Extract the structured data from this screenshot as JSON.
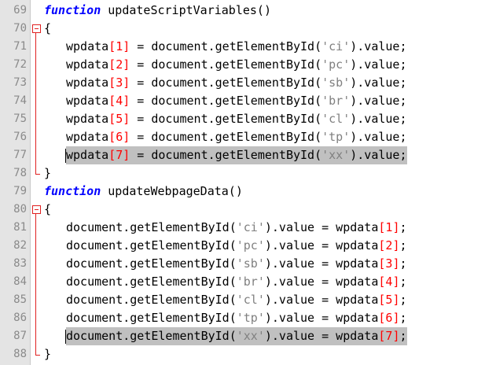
{
  "editor": {
    "lines": [
      {
        "num": "69",
        "tokens": [
          {
            "t": "kw",
            "v": "function"
          },
          {
            "t": "p",
            "v": " updateScriptVariables()"
          }
        ]
      },
      {
        "num": "70",
        "tokens": [
          {
            "t": "p",
            "v": "{"
          }
        ]
      },
      {
        "num": "71",
        "tokens": [
          {
            "t": "p",
            "v": "wpdata"
          },
          {
            "t": "br",
            "v": "["
          },
          {
            "t": "num",
            "v": "1"
          },
          {
            "t": "br",
            "v": "]"
          },
          {
            "t": "p",
            "v": " = document.getElementById("
          },
          {
            "t": "str",
            "v": "'ci'"
          },
          {
            "t": "p",
            "v": ").value;"
          }
        ]
      },
      {
        "num": "72",
        "tokens": [
          {
            "t": "p",
            "v": "wpdata"
          },
          {
            "t": "br",
            "v": "["
          },
          {
            "t": "num",
            "v": "2"
          },
          {
            "t": "br",
            "v": "]"
          },
          {
            "t": "p",
            "v": " = document.getElementById("
          },
          {
            "t": "str",
            "v": "'pc'"
          },
          {
            "t": "p",
            "v": ").value;"
          }
        ]
      },
      {
        "num": "73",
        "tokens": [
          {
            "t": "p",
            "v": "wpdata"
          },
          {
            "t": "br",
            "v": "["
          },
          {
            "t": "num",
            "v": "3"
          },
          {
            "t": "br",
            "v": "]"
          },
          {
            "t": "p",
            "v": " = document.getElementById("
          },
          {
            "t": "str",
            "v": "'sb'"
          },
          {
            "t": "p",
            "v": ").value;"
          }
        ]
      },
      {
        "num": "74",
        "tokens": [
          {
            "t": "p",
            "v": "wpdata"
          },
          {
            "t": "br",
            "v": "["
          },
          {
            "t": "num",
            "v": "4"
          },
          {
            "t": "br",
            "v": "]"
          },
          {
            "t": "p",
            "v": " = document.getElementById("
          },
          {
            "t": "str",
            "v": "'br'"
          },
          {
            "t": "p",
            "v": ").value;"
          }
        ]
      },
      {
        "num": "75",
        "tokens": [
          {
            "t": "p",
            "v": "wpdata"
          },
          {
            "t": "br",
            "v": "["
          },
          {
            "t": "num",
            "v": "5"
          },
          {
            "t": "br",
            "v": "]"
          },
          {
            "t": "p",
            "v": " = document.getElementById("
          },
          {
            "t": "str",
            "v": "'cl'"
          },
          {
            "t": "p",
            "v": ").value;"
          }
        ]
      },
      {
        "num": "76",
        "tokens": [
          {
            "t": "p",
            "v": "wpdata"
          },
          {
            "t": "br",
            "v": "["
          },
          {
            "t": "num",
            "v": "6"
          },
          {
            "t": "br",
            "v": "]"
          },
          {
            "t": "p",
            "v": " = document.getElementById("
          },
          {
            "t": "str",
            "v": "'tp'"
          },
          {
            "t": "p",
            "v": ").value;"
          }
        ]
      },
      {
        "num": "77",
        "highlight": true,
        "tokens": [
          {
            "t": "p",
            "v": "wpdata"
          },
          {
            "t": "br",
            "v": "["
          },
          {
            "t": "num",
            "v": "7"
          },
          {
            "t": "br",
            "v": "]"
          },
          {
            "t": "p",
            "v": " = document.getElementById("
          },
          {
            "t": "str",
            "v": "'xx'"
          },
          {
            "t": "p",
            "v": ").value;"
          }
        ]
      },
      {
        "num": "78",
        "tokens": [
          {
            "t": "p",
            "v": "}"
          }
        ]
      },
      {
        "num": "79",
        "tokens": [
          {
            "t": "kw",
            "v": "function"
          },
          {
            "t": "p",
            "v": " updateWebpageData()"
          }
        ]
      },
      {
        "num": "80",
        "tokens": [
          {
            "t": "p",
            "v": "{"
          }
        ]
      },
      {
        "num": "81",
        "tokens": [
          {
            "t": "p",
            "v": "document.getElementById("
          },
          {
            "t": "str",
            "v": "'ci'"
          },
          {
            "t": "p",
            "v": ").value = wpdata"
          },
          {
            "t": "br",
            "v": "["
          },
          {
            "t": "num",
            "v": "1"
          },
          {
            "t": "br",
            "v": "]"
          },
          {
            "t": "p",
            "v": ";"
          }
        ]
      },
      {
        "num": "82",
        "tokens": [
          {
            "t": "p",
            "v": "document.getElementById("
          },
          {
            "t": "str",
            "v": "'pc'"
          },
          {
            "t": "p",
            "v": ").value = wpdata"
          },
          {
            "t": "br",
            "v": "["
          },
          {
            "t": "num",
            "v": "2"
          },
          {
            "t": "br",
            "v": "]"
          },
          {
            "t": "p",
            "v": ";"
          }
        ]
      },
      {
        "num": "83",
        "tokens": [
          {
            "t": "p",
            "v": "document.getElementById("
          },
          {
            "t": "str",
            "v": "'sb'"
          },
          {
            "t": "p",
            "v": ").value = wpdata"
          },
          {
            "t": "br",
            "v": "["
          },
          {
            "t": "num",
            "v": "3"
          },
          {
            "t": "br",
            "v": "]"
          },
          {
            "t": "p",
            "v": ";"
          }
        ]
      },
      {
        "num": "84",
        "tokens": [
          {
            "t": "p",
            "v": "document.getElementById("
          },
          {
            "t": "str",
            "v": "'br'"
          },
          {
            "t": "p",
            "v": ").value = wpdata"
          },
          {
            "t": "br",
            "v": "["
          },
          {
            "t": "num",
            "v": "4"
          },
          {
            "t": "br",
            "v": "]"
          },
          {
            "t": "p",
            "v": ";"
          }
        ]
      },
      {
        "num": "85",
        "tokens": [
          {
            "t": "p",
            "v": "document.getElementById("
          },
          {
            "t": "str",
            "v": "'cl'"
          },
          {
            "t": "p",
            "v": ").value = wpdata"
          },
          {
            "t": "br",
            "v": "["
          },
          {
            "t": "num",
            "v": "5"
          },
          {
            "t": "br",
            "v": "]"
          },
          {
            "t": "p",
            "v": ";"
          }
        ]
      },
      {
        "num": "86",
        "tokens": [
          {
            "t": "p",
            "v": "document.getElementById("
          },
          {
            "t": "str",
            "v": "'tp'"
          },
          {
            "t": "p",
            "v": ").value = wpdata"
          },
          {
            "t": "br",
            "v": "["
          },
          {
            "t": "num",
            "v": "6"
          },
          {
            "t": "br",
            "v": "]"
          },
          {
            "t": "p",
            "v": ";"
          }
        ]
      },
      {
        "num": "87",
        "highlight": true,
        "tokens": [
          {
            "t": "p",
            "v": "document.getElementById("
          },
          {
            "t": "str",
            "v": "'xx'"
          },
          {
            "t": "p",
            "v": ").value = wpdata"
          },
          {
            "t": "br",
            "v": "["
          },
          {
            "t": "num",
            "v": "7"
          },
          {
            "t": "br",
            "v": "]"
          },
          {
            "t": "p",
            "v": ";"
          }
        ]
      },
      {
        "num": "88",
        "tokens": [
          {
            "t": "p",
            "v": "}"
          }
        ]
      }
    ]
  },
  "colors": {
    "keyword": "#0000ff",
    "number": "#ff0000",
    "string": "#808080",
    "highlight": "#c0c0c0",
    "fold_marker": "#e02020",
    "gutter": "#e4e4e4"
  }
}
